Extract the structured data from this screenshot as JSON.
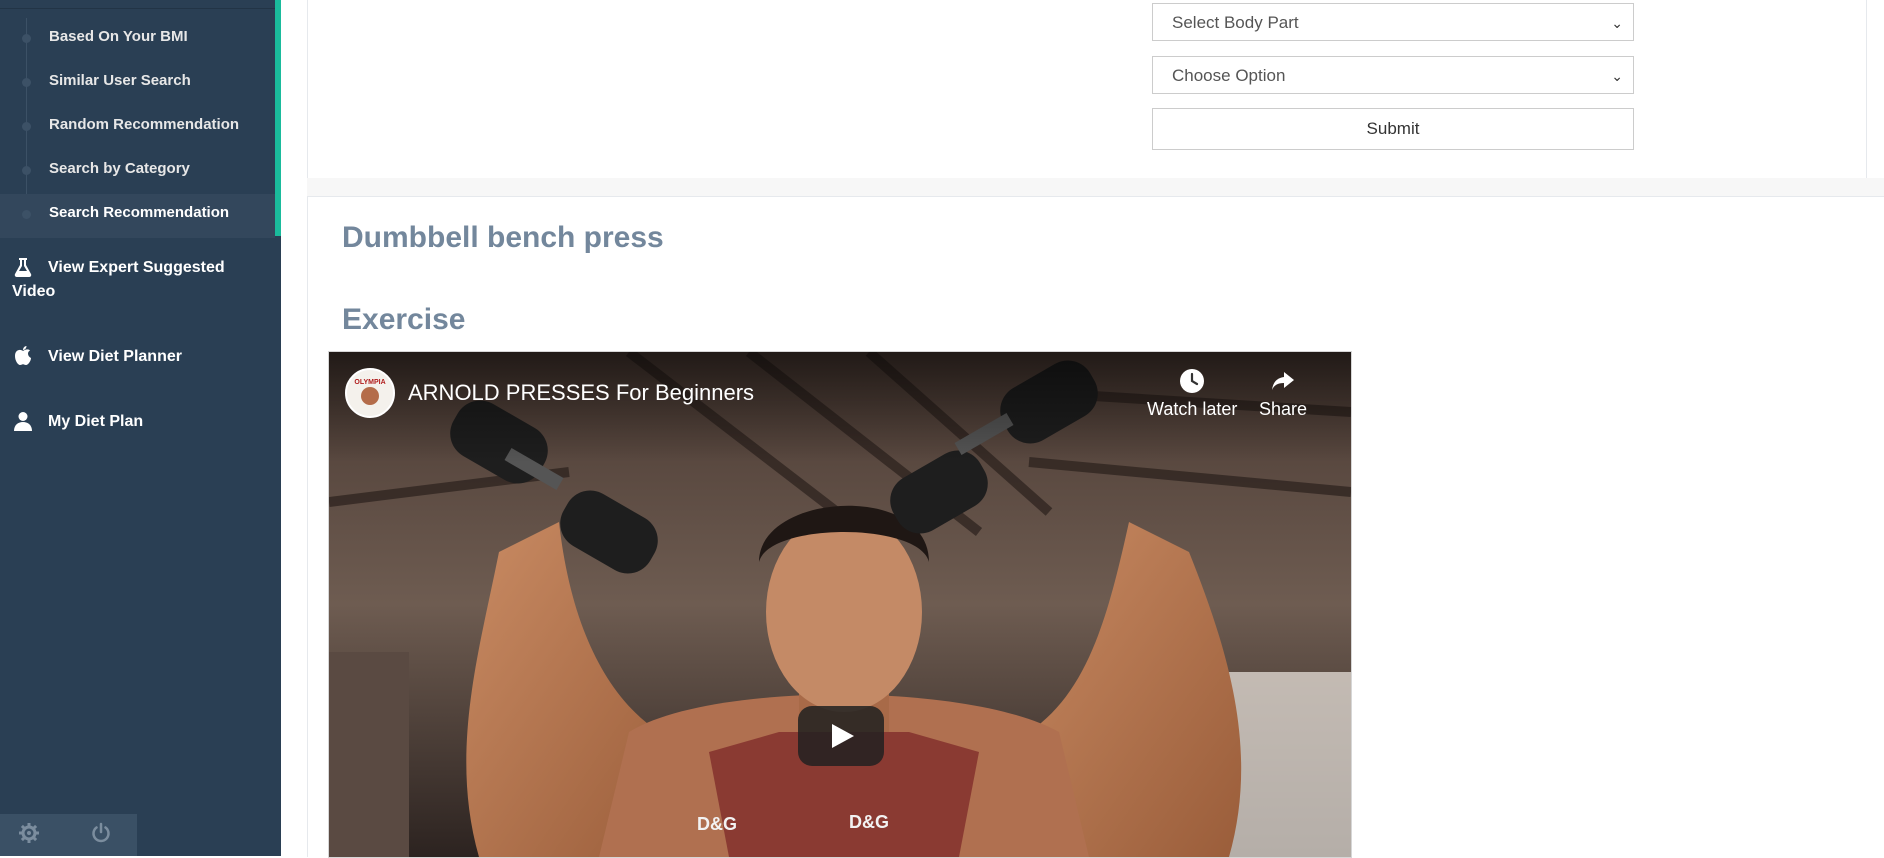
{
  "sidebar": {
    "sub_items": [
      {
        "label": "Based On Your BMI",
        "active": false
      },
      {
        "label": "Similar User Search",
        "active": false
      },
      {
        "label": "Random Recommendation",
        "active": false
      },
      {
        "label": "Search by Category",
        "active": false
      },
      {
        "label": "Search Recommendation",
        "active": true
      }
    ],
    "menu": [
      {
        "label": "View Expert Suggested Video",
        "icon": "flask-icon"
      },
      {
        "label": "View Diet Planner",
        "icon": "apple-icon"
      },
      {
        "label": "My Diet Plan",
        "icon": "user-icon"
      }
    ],
    "footer": {
      "settings_icon": "gear-icon",
      "logout_icon": "power-icon"
    }
  },
  "form": {
    "body_part_select": "Select Body Part",
    "option_select": "Choose Option",
    "submit_label": "Submit"
  },
  "result": {
    "exercise_name": "Dumbbell bench press",
    "section_heading": "Exercise",
    "video": {
      "title": "ARNOLD PRESSES For Beginners",
      "channel_avatar_text": "OLYMPIA",
      "watch_later_label": "Watch later",
      "share_label": "Share",
      "shirt_text_left": "D&G",
      "shirt_text_right": "D&G"
    }
  },
  "colors": {
    "sidebar_bg": "#2a3f54",
    "accent": "#1abb9c",
    "heading": "#73879c"
  }
}
